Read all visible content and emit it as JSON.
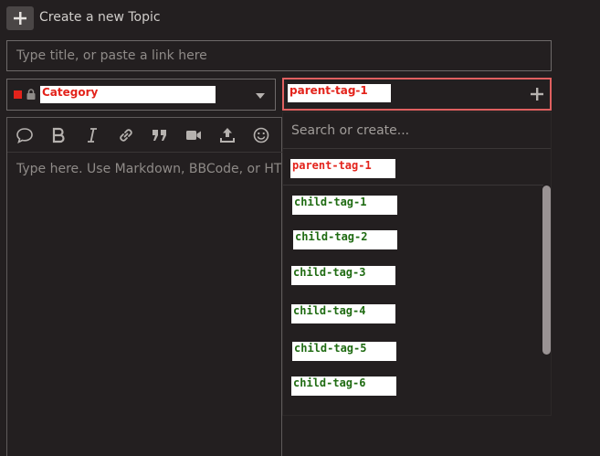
{
  "header": {
    "title": "Create a new Topic",
    "new_icon": "plus-icon"
  },
  "title_input": {
    "placeholder": "Type title, or paste a link here"
  },
  "category": {
    "label": "Category",
    "color": "#e3231b",
    "icons": [
      "lock-icon",
      "caret-down-icon"
    ]
  },
  "tags": {
    "selected": "parent-tag-1",
    "add_icon": "plus-icon",
    "search_placeholder": "Search or create...",
    "options": [
      {
        "label": "parent-tag-1",
        "kind": "parent"
      },
      {
        "label": "child-tag-1",
        "kind": "child"
      },
      {
        "label": "child-tag-2",
        "kind": "child"
      },
      {
        "label": "child-tag-3",
        "kind": "child"
      },
      {
        "label": "child-tag-4",
        "kind": "child"
      },
      {
        "label": "child-tag-5",
        "kind": "child"
      },
      {
        "label": "child-tag-6",
        "kind": "child"
      }
    ]
  },
  "editor": {
    "placeholder": "Type here. Use Markdown, BBCode, or HTML to format. Drag or paste images.",
    "toolbar_icons": [
      "speech-bubble-icon",
      "bold-icon",
      "italic-icon",
      "link-icon",
      "quote-icon",
      "video-icon",
      "upload-icon",
      "emoji-icon"
    ]
  },
  "colors": {
    "background": "#231f20",
    "accent_red": "#e3231b",
    "child_tag_green": "#1f6b12",
    "focus_border": "#e06060"
  }
}
